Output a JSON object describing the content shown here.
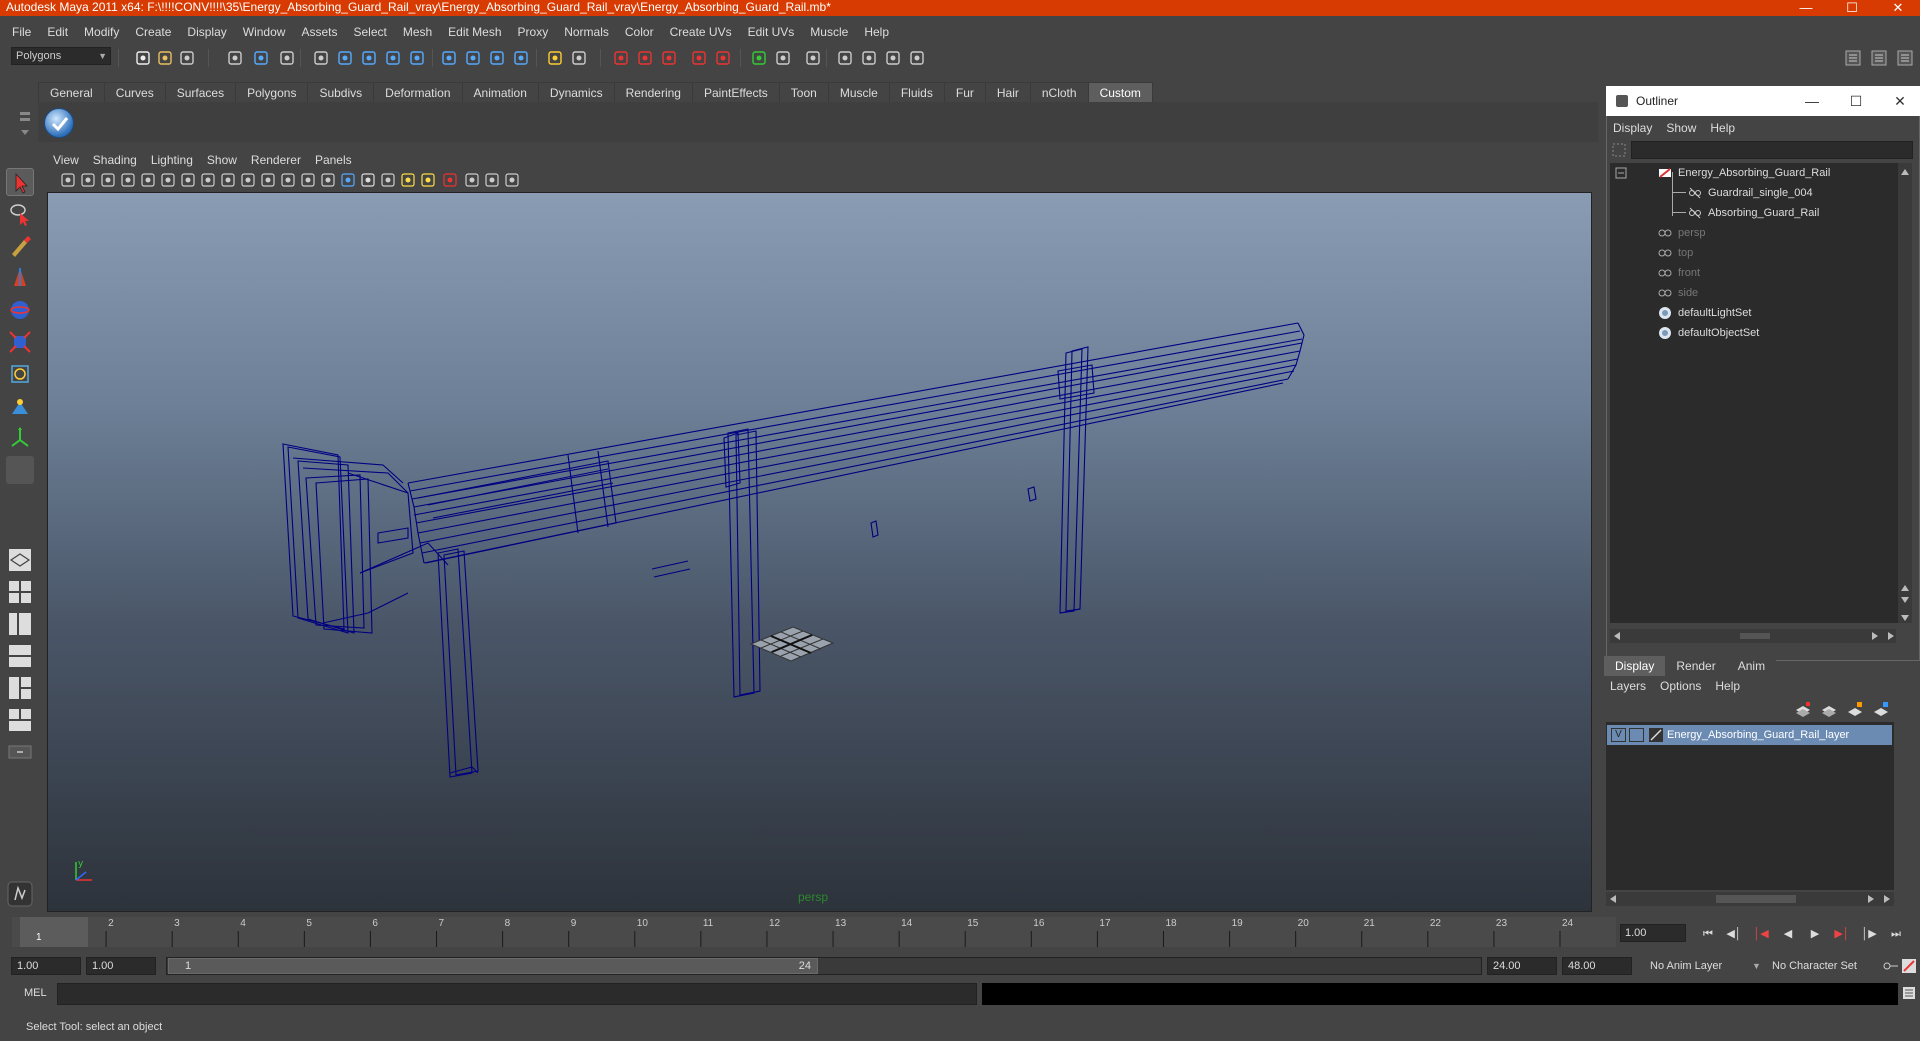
{
  "window": {
    "title": "Autodesk Maya 2011 x64: F:\\!!!!CONV!!!!\\35\\Energy_Absorbing_Guard_Rail_vray\\Energy_Absorbing_Guard_Rail_vray\\Energy_Absorbing_Guard_Rail.mb*",
    "title_bar_color": "#d83b01",
    "controls": [
      "minimize-icon",
      "maximize-icon",
      "close-icon"
    ]
  },
  "menubar": [
    "File",
    "Edit",
    "Modify",
    "Create",
    "Display",
    "Window",
    "Assets",
    "Select",
    "Mesh",
    "Edit Mesh",
    "Proxy",
    "Normals",
    "Color",
    "Create UVs",
    "Edit UVs",
    "Muscle",
    "Help"
  ],
  "status_line": {
    "mode": "Polygons"
  },
  "shelf": {
    "tabs": [
      "General",
      "Curves",
      "Surfaces",
      "Polygons",
      "Subdivs",
      "Deformation",
      "Animation",
      "Dynamics",
      "Rendering",
      "PaintEffects",
      "Toon",
      "Muscle",
      "Fluids",
      "Fur",
      "Hair",
      "nCloth",
      "Custom"
    ],
    "active_tab": "Custom"
  },
  "viewport": {
    "menus": [
      "View",
      "Shading",
      "Lighting",
      "Show",
      "Renderer",
      "Panels"
    ],
    "camera_label": "persp",
    "wireframe_color": "#000080"
  },
  "outliner": {
    "title": "Outliner",
    "menus": [
      "Display",
      "Show",
      "Help"
    ],
    "items": [
      {
        "label": "Energy_Absorbing_Guard_Rail",
        "depth": 0,
        "icon": "group-icon",
        "dim": false
      },
      {
        "label": "Guardrail_single_004",
        "depth": 1,
        "icon": "mesh-icon",
        "dim": false
      },
      {
        "label": "Absorbing_Guard_Rail",
        "depth": 1,
        "icon": "mesh-icon",
        "dim": false
      },
      {
        "label": "persp",
        "depth": 0,
        "icon": "camera-icon",
        "dim": true
      },
      {
        "label": "top",
        "depth": 0,
        "icon": "camera-icon",
        "dim": true
      },
      {
        "label": "front",
        "depth": 0,
        "icon": "camera-icon",
        "dim": true
      },
      {
        "label": "side",
        "depth": 0,
        "icon": "camera-icon",
        "dim": true
      },
      {
        "label": "defaultLightSet",
        "depth": 0,
        "icon": "set-icon",
        "dim": false
      },
      {
        "label": "defaultObjectSet",
        "depth": 0,
        "icon": "set-icon",
        "dim": false
      }
    ]
  },
  "layer_editor": {
    "tabs": [
      "Display",
      "Render",
      "Anim"
    ],
    "active_tab": "Display",
    "menus": [
      "Layers",
      "Options",
      "Help"
    ],
    "layers": [
      {
        "visible": "V",
        "name": "Energy_Absorbing_Guard_Rail_layer"
      }
    ],
    "selected_color": "#6b8bb3"
  },
  "time_slider": {
    "ticks": [
      "1",
      "2",
      "3",
      "4",
      "5",
      "6",
      "7",
      "8",
      "9",
      "10",
      "11",
      "12",
      "13",
      "14",
      "15",
      "16",
      "17",
      "18",
      "19",
      "20",
      "21",
      "22",
      "23",
      "24"
    ],
    "current_frame_marker": "1",
    "current_frame": "1.00"
  },
  "range_slider": {
    "start_time": "1.00",
    "playback_start": "1.00",
    "range_start_label": "1",
    "range_end_label": "24",
    "playback_end": "24.00",
    "end_time": "48.00",
    "anim_layer": "No Anim Layer",
    "character_set": "No Character Set"
  },
  "command_line": {
    "label": "MEL"
  },
  "help_line": "Select Tool: select an object"
}
